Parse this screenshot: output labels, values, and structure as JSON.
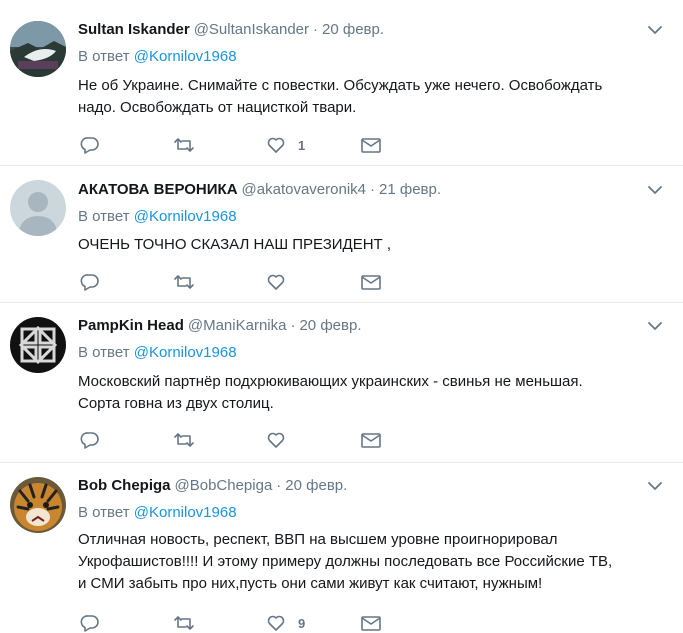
{
  "reply_prefix": "В ответ",
  "tweets": [
    {
      "name": "Sultan Iskander",
      "handle": "@SultanIskander",
      "separator": "·",
      "date": "20 февр.",
      "reply_to": "@Kornilov1968",
      "lines": [
        "Не об Украине. Снимайте с повестки. Обсуждать уже нечего. Освобождать",
        "надо. Освобождать от нацисткой твари."
      ],
      "likes": "1",
      "avatar": "landscape-photo"
    },
    {
      "name": "АКАТОВА ВЕРОНИКА",
      "handle": "@akatovaveronik4",
      "separator": "·",
      "date": "21 февр.",
      "reply_to": "@Kornilov1968",
      "lines": [
        "ОЧЕНЬ ТОЧНО СКАЗАЛ НАШ ПРЕЗИДЕНТ ,"
      ],
      "likes": "",
      "avatar": "default-user"
    },
    {
      "name": "PampKin Head",
      "handle": "@ManiKarnika",
      "separator": "·",
      "date": "20 февр.",
      "reply_to": "@Kornilov1968",
      "lines": [
        "Московский партнёр подхрюкивающих украинских - свинья не меньшая.",
        "Сорта говна из двух столиц."
      ],
      "likes": "",
      "avatar": "knot-symbol"
    },
    {
      "name": "Bob Chepiga",
      "handle": "@BobChepiga",
      "separator": "·",
      "date": "20 февр.",
      "reply_to": "@Kornilov1968",
      "lines": [
        "Отличная новость, респект, ВВП на высшем уровне проигнорировал",
        "Укрофашистов!!!! И этому примеру должны последовать все Российские ТВ,",
        "и СМИ забыть про них,пусть они сами живут как считают, нужным!"
      ],
      "likes": "9",
      "avatar": "tiger-photo"
    }
  ]
}
